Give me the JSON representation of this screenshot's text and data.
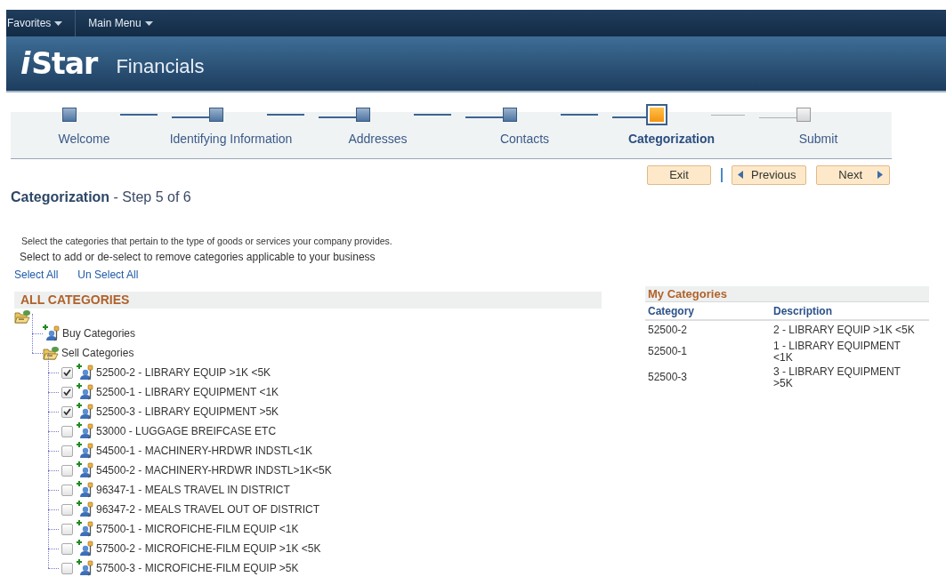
{
  "top_menu": [
    {
      "label": "Favorites"
    },
    {
      "label": "Main Menu"
    }
  ],
  "banner": {
    "logo_mark": "i",
    "logo_word": "Star",
    "product": "Financials"
  },
  "steps": [
    {
      "label": "Welcome",
      "completed": true,
      "selected": false
    },
    {
      "label": "Identifying Information",
      "completed": true,
      "selected": false
    },
    {
      "label": "Addresses",
      "completed": true,
      "selected": false
    },
    {
      "label": "Contacts",
      "completed": true,
      "selected": false
    },
    {
      "label": "Categorization",
      "completed": false,
      "selected": true
    },
    {
      "label": "Submit",
      "completed": false,
      "selected": false
    }
  ],
  "nav_buttons": {
    "exit": "Exit",
    "previous": "Previous",
    "next": "Next"
  },
  "page_title": {
    "title": "Categorization",
    "subtitle": "- Step 5 of 6"
  },
  "instructions": [
    "Select the categories that pertain to the type of goods or services your company provides.",
    "Select to add or de-select to remove categories applicable to your business"
  ],
  "links": [
    "Select All",
    "Un Select All"
  ],
  "all_categories": {
    "title": "ALL CATEGORIES",
    "tree": {
      "children": [
        {
          "label": "Buy Categories",
          "expanded": false
        },
        {
          "label": "Sell Categories",
          "expanded": true,
          "children": [
            {
              "label": "52500-2 - LIBRARY EQUIP >1K <5K",
              "checked": true
            },
            {
              "label": "52500-1 - LIBRARY EQUIPMENT <1K",
              "checked": true
            },
            {
              "label": "52500-3 - LIBRARY EQUIPMENT >5K",
              "checked": true
            },
            {
              "label": "53000 - LUGGAGE BREIFCASE ETC",
              "checked": false
            },
            {
              "label": "54500-1 - MACHINERY-HRDWR INDSTL<1K",
              "checked": false
            },
            {
              "label": "54500-2 - MACHINERY-HRDWR INDSTL>1K<5K",
              "checked": false
            },
            {
              "label": "96347-1 - MEALS TRAVEL IN DISTRICT",
              "checked": false
            },
            {
              "label": "96347-2 - MEALS TRAVEL OUT OF DISTRICT",
              "checked": false
            },
            {
              "label": "57500-1 - MICROFICHE-FILM EQUIP <1K",
              "checked": false
            },
            {
              "label": "57500-2 - MICROFICHE-FILM EQUIP >1K <5K",
              "checked": false
            },
            {
              "label": "57500-3 - MICROFICHE-FILM EQUIP >5K",
              "checked": false
            }
          ]
        }
      ]
    }
  },
  "my_categories": {
    "title": "My Categories",
    "columns": [
      "Category",
      "Description"
    ],
    "rows": [
      [
        "52500-2",
        "2 - LIBRARY EQUIP >1K <5K"
      ],
      [
        "52500-1",
        "1 - LIBRARY EQUIPMENT <1K"
      ],
      [
        "52500-3",
        "3 - LIBRARY EQUIPMENT >5K"
      ]
    ]
  }
}
